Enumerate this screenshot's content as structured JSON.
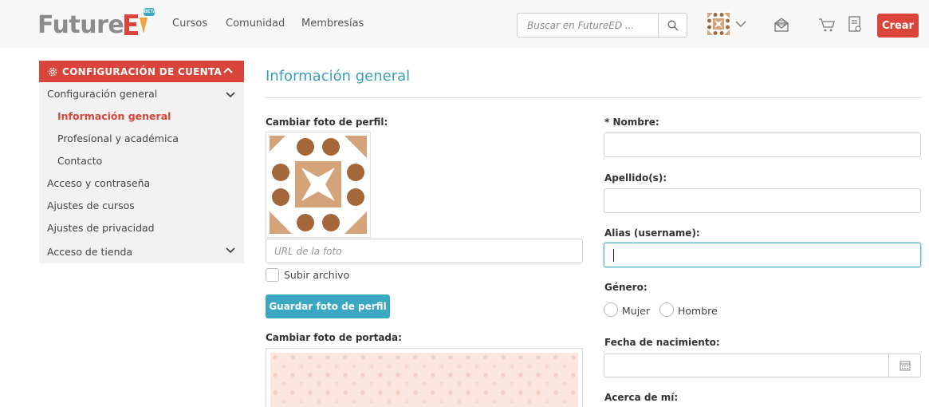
{
  "header": {
    "logo_text": "Future",
    "logo_badge": "BETA",
    "nav": [
      {
        "label": "Cursos"
      },
      {
        "label": "Comunidad"
      },
      {
        "label": "Membresías"
      }
    ],
    "search": {
      "placeholder": "Buscar en FutureED ..."
    },
    "create_label": "Crear"
  },
  "sidebar": {
    "header_label": "CONFIGURACIÓN DE CUENTA",
    "items": [
      {
        "label": "Configuración general",
        "expanded": true
      },
      {
        "label": "Información general",
        "active": true
      },
      {
        "label": "Profesional y académica"
      },
      {
        "label": "Contacto"
      },
      {
        "label": "Acceso y contraseña"
      },
      {
        "label": "Ajustes de cursos"
      },
      {
        "label": "Ajustes de privacidad"
      },
      {
        "label": "Acceso de tienda",
        "expandable": true
      }
    ]
  },
  "main": {
    "title": "Información general",
    "profile_photo": {
      "label": "Cambiar foto de perfil:",
      "url_placeholder": "URL de la foto",
      "upload_label": "Subir archivo",
      "save_label": "Guardar foto de perfil"
    },
    "cover_photo": {
      "label": "Cambiar foto de portada:"
    },
    "form": {
      "name_label": "* Nombre:",
      "name_value": "",
      "surname_label": "Apellido(s):",
      "surname_value": "",
      "alias_label": "Alias (username):",
      "alias_value": "",
      "gender_label": "Género:",
      "gender_options": [
        "Mujer",
        "Hombre"
      ],
      "birthdate_label": "Fecha de nacimiento:",
      "birthdate_value": "",
      "about_label": "Acerca de mí:"
    }
  },
  "colors": {
    "accent_red": "#d9453a",
    "accent_teal": "#3aa8c1",
    "avatar_tan": "#d4a37a",
    "avatar_brown": "#a4673a"
  }
}
